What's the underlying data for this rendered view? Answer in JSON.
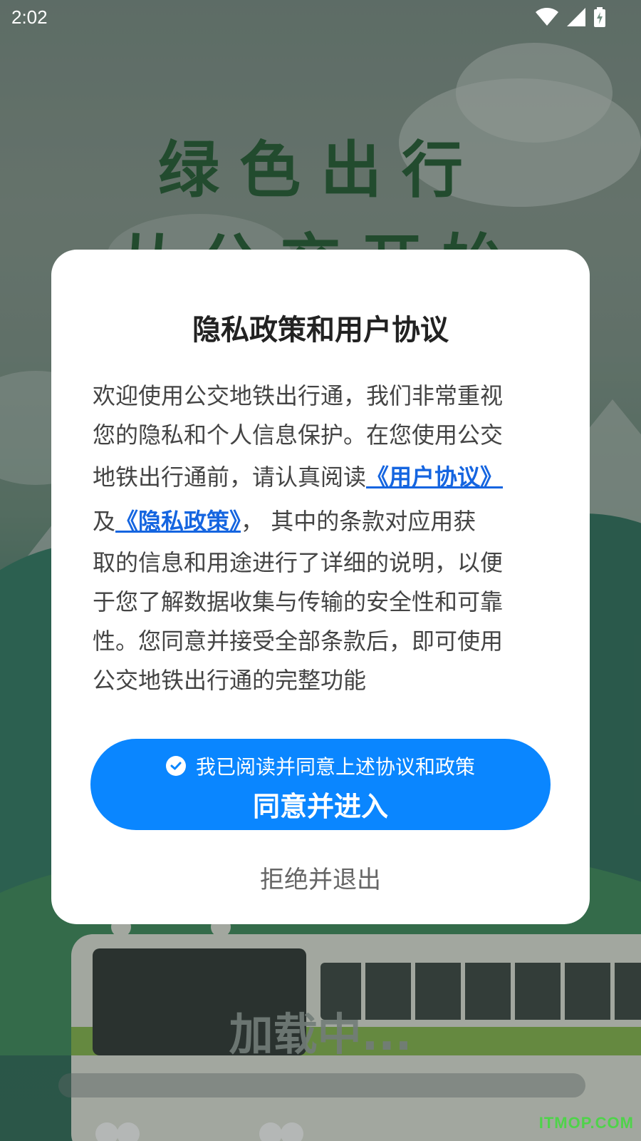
{
  "status_bar": {
    "time": "2:02",
    "icons": [
      "wifi-icon",
      "signal-icon",
      "battery-charging-icon"
    ]
  },
  "splash": {
    "slogan_line1": "绿色出行",
    "slogan_line2": "从公交开始",
    "loading_text": "加载中..."
  },
  "dialog": {
    "title": "隐私政策和用户协议",
    "body": {
      "line1": "欢迎使用公交地铁出行通，我们非常重视",
      "line2": "您的隐私和个人信息保护。在您使用公交",
      "line3_prefix": "地铁出行通前，请认真阅读",
      "user_agreement_link": "《用户协议》",
      "line4_prefix": "及",
      "privacy_policy_link": "《隐私政策》",
      "line4_suffix": "， 其中的条款对应用获",
      "line5": "取的信息和用途进行了详细的说明，以便",
      "line6": "于您了解数据收集与传输的安全性和可靠",
      "line7": "性。您同意并接受全部条款后，即可使用",
      "line8": "公交地铁出行通的完整功能"
    },
    "agree_checkbox_label": "我已阅读并同意上述协议和政策",
    "agree_checked": true,
    "agree_button_label": "同意并进入",
    "reject_button_label": "拒绝并退出"
  },
  "watermark": "ITMOP.COM",
  "colors": {
    "primary_button": "#0a86ff",
    "link": "#1565e0",
    "slogan": "#1f5a2e",
    "watermark": "#4fd34a"
  }
}
